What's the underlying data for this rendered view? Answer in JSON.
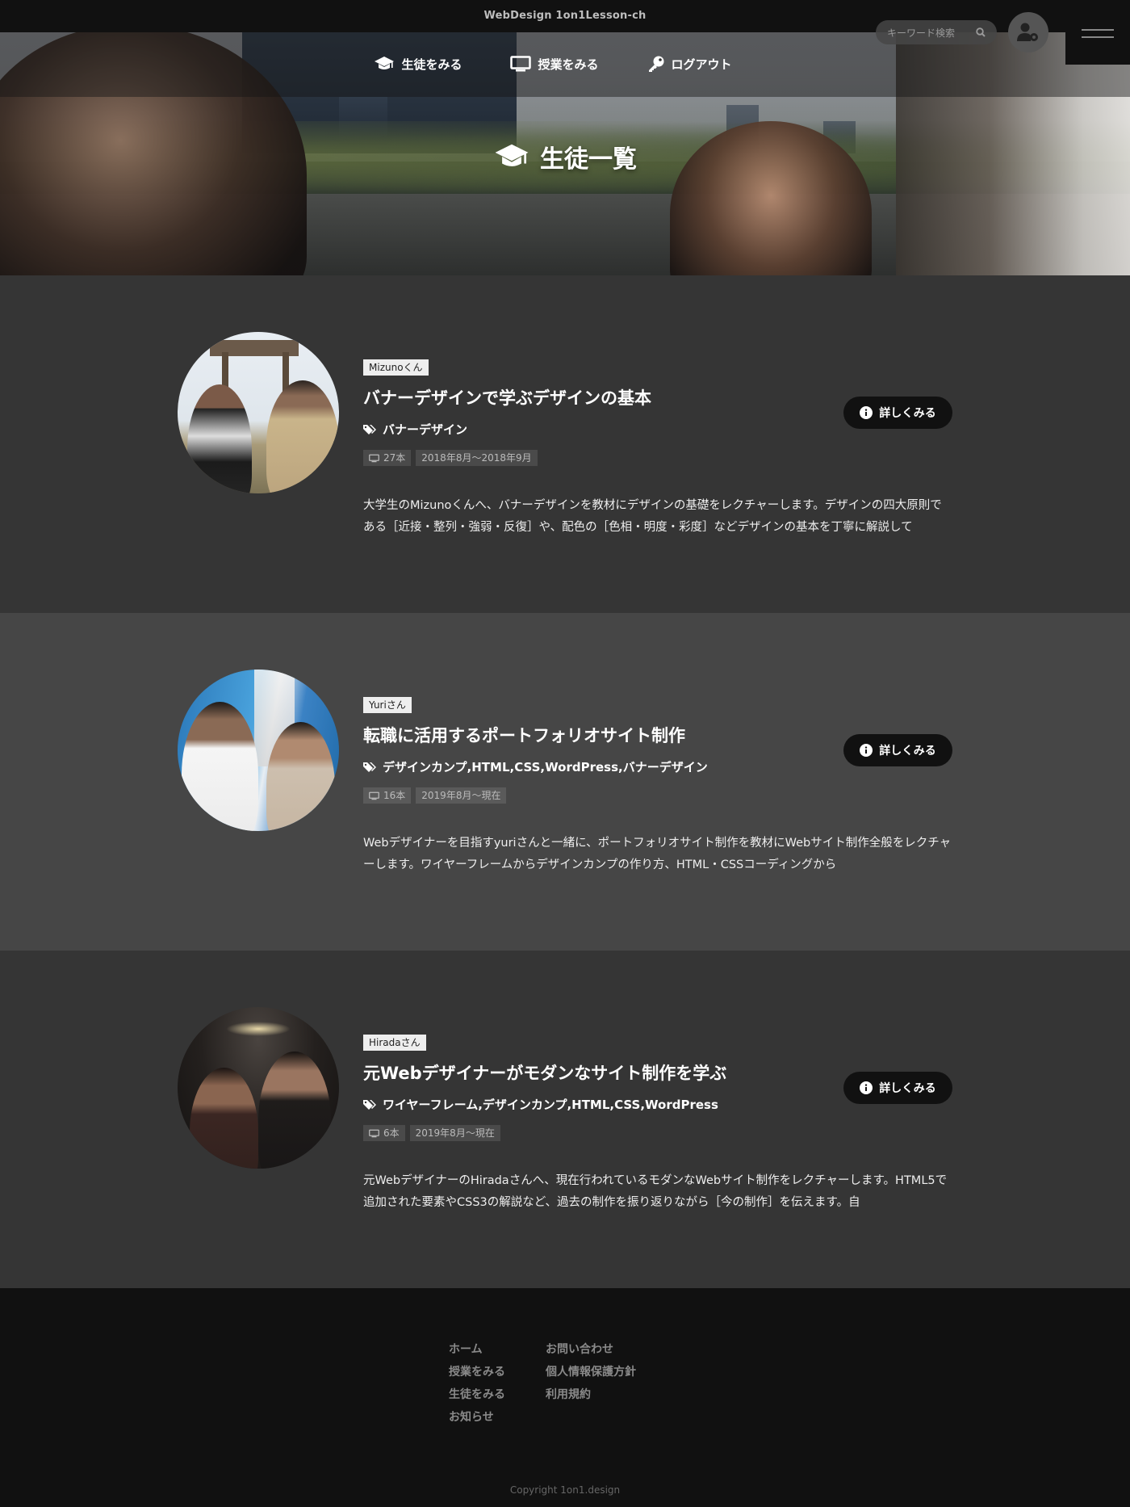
{
  "header": {
    "site_title": "WebDesign 1on1Lesson-ch",
    "nav": [
      {
        "label": "生徒をみる",
        "icon": "graduation-cap-icon"
      },
      {
        "label": "授業をみる",
        "icon": "monitor-icon"
      },
      {
        "label": "ログアウト",
        "icon": "key-icon"
      }
    ],
    "search_placeholder": "キーワード検索",
    "user_icon": "user-gear-icon",
    "menu_icon": "hamburger-icon"
  },
  "page_title": "生徒一覧",
  "students": [
    {
      "name": "Mizunoくん",
      "title": "バナーデザインで学ぶデザインの基本",
      "tags": "バナーデザイン",
      "count": "27本",
      "period": "2018年8月〜2018年9月",
      "description": "大学生のMizunoくんへ、バナーデザインを教材にデザインの基礎をレクチャーします。デザインの四大原則である［近接・整列・強弱・反復］や、配色の［色相・明度・彩度］などデザインの基本を丁寧に解説して",
      "button": "詳しくみる"
    },
    {
      "name": "Yuriさん",
      "title": "転職に活用するポートフォリオサイト制作",
      "tags": "デザインカンプ,HTML,CSS,WordPress,バナーデザイン",
      "count": "16本",
      "period": "2019年8月〜現在",
      "description": "Webデザイナーを目指すyuriさんと一緒に、ポートフォリオサイト制作を教材にWebサイト制作全般をレクチャーします。ワイヤーフレームからデザインカンプの作り方、HTML・CSSコーディングから",
      "button": "詳しくみる"
    },
    {
      "name": "Hiradaさん",
      "title": "元Webデザイナーがモダンなサイト制作を学ぶ",
      "tags": "ワイヤーフレーム,デザインカンプ,HTML,CSS,WordPress",
      "count": "6本",
      "period": "2019年8月〜現在",
      "description": "元WebデザイナーのHiradaさんへ、現在行われているモダンなWebサイト制作をレクチャーします。HTML5で追加された要素やCSS3の解説など、過去の制作を振り返りながら［今の制作］を伝えます。自",
      "button": "詳しくみる"
    }
  ],
  "footer": {
    "col1": [
      "ホーム",
      "授業をみる",
      "生徒をみる",
      "お知らせ"
    ],
    "col2": [
      "お問い合わせ",
      "個人情報保護方針",
      "利用規約"
    ],
    "copyright": "Copyright 1on1.design"
  },
  "colors": {
    "topbar": "#111111",
    "section_dark": "#353535",
    "section_light": "#464646",
    "button": "#111111",
    "footer": "#111111"
  }
}
